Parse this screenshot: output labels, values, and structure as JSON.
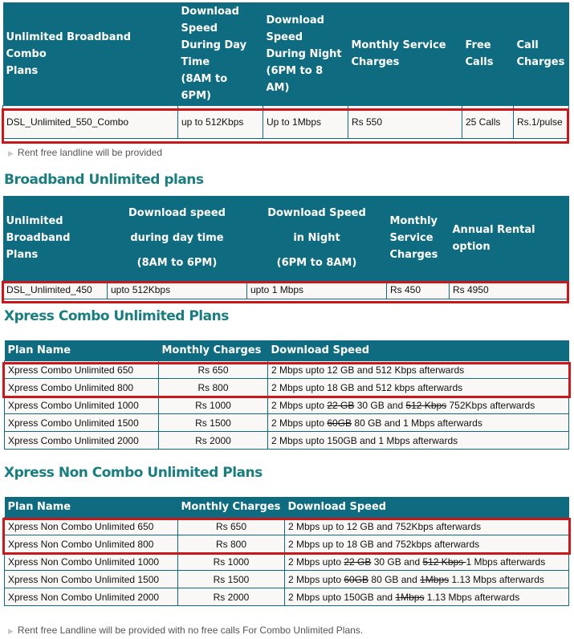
{
  "combo_table": {
    "headers": [
      "Unlimited Broadband Combo Plans",
      "Download Speed During Day Time (8AM to 6PM)",
      "Download Speed During Night (6PM to 8 AM)",
      "Monthly Service Charges",
      "Free Calls",
      "Call Charges"
    ],
    "header_lines": {
      "h0": [
        "Unlimited Broadband Combo",
        "Plans"
      ],
      "h1": [
        "Download",
        "Speed",
        "During Day",
        "Time",
        "(8AM to 6PM)"
      ],
      "h2": [
        "Download",
        "Speed",
        "During Night",
        "(6PM to 8 AM)"
      ],
      "h3": [
        "Monthly Service",
        "Charges"
      ],
      "h4": [
        "Free",
        "Calls"
      ],
      "h5": [
        "Call",
        "Charges"
      ]
    },
    "rows": [
      [
        "DSL_Unlimited_550_Combo",
        "up to 512Kbps",
        "Up to 1Mbps",
        "Rs 550",
        "25 Calls",
        "Rs.1/pulse"
      ]
    ],
    "highlighted_rows": [
      0
    ]
  },
  "combo_note": "Rent free landline will be provided",
  "broadband_section": {
    "title": "Broadband Unlimited plans",
    "header_lines": {
      "h0": [
        "Unlimited",
        "Broadband Plans"
      ],
      "h1": [
        "Download speed",
        "during day time",
        "(8AM to 6PM)"
      ],
      "h2": [
        "Download Speed",
        "in Night",
        "(6PM to 8AM)"
      ],
      "h3": [
        "Monthly",
        "Service",
        "Charges"
      ],
      "h4": [
        "Annual Rental",
        "option"
      ]
    },
    "rows": [
      [
        "DSL_Unlimited_450",
        "upto 512Kbps",
        "upto 1 Mbps",
        "Rs 450",
        "Rs 4950"
      ]
    ],
    "highlighted_rows": [
      0
    ]
  },
  "xpress_combo": {
    "title": "Xpress Combo Unlimited Plans",
    "headers": [
      "Plan Name",
      "Monthly Charges",
      "Download Speed"
    ],
    "rows": [
      {
        "name": "Xpress Combo Unlimited 650",
        "charge": "Rs 650",
        "speed": [
          {
            "t": "2 Mbps upto 12 GB and 512 Kbps afterwards"
          }
        ]
      },
      {
        "name": "Xpress Combo Unlimited 800",
        "charge": "Rs 800",
        "speed": [
          {
            "t": "2 Mbps upto 18 GB and 512 kbps afterwards"
          }
        ]
      },
      {
        "name": "Xpress Combo Unlimited 1000",
        "charge": "Rs 1000",
        "speed": [
          {
            "t": "2 Mbps upto "
          },
          {
            "t": "22 GB",
            "struck": true
          },
          {
            "t": " 30 GB and  "
          },
          {
            "t": "512 Kbps",
            "struck": true
          },
          {
            "t": " 752Kbps afterwards"
          }
        ]
      },
      {
        "name": "Xpress Combo Unlimited 1500",
        "charge": "Rs 1500",
        "speed": [
          {
            "t": "2 Mbps upto "
          },
          {
            "t": "60GB",
            "struck": true
          },
          {
            "t": " 80 GB and 1 Mbps afterwards"
          }
        ]
      },
      {
        "name": "Xpress Combo Unlimited 2000",
        "charge": "Rs 2000",
        "speed": [
          {
            "t": "2 Mbps upto 150GB and 1 Mbps afterwards"
          }
        ]
      }
    ],
    "highlighted_rows": [
      0,
      1
    ]
  },
  "xpress_non_combo": {
    "title": "Xpress Non Combo Unlimited Plans",
    "headers": [
      "Plan Name",
      "Monthly Charges",
      "Download Speed"
    ],
    "rows": [
      {
        "name": "Xpress Non Combo Unlimited 650",
        "charge": "Rs 650",
        "speed": [
          {
            "t": "2 Mbps up to 12 GB and 752Kbps afterwards"
          }
        ]
      },
      {
        "name": "Xpress Non Combo Unlimited 800",
        "charge": "Rs 800",
        "speed": [
          {
            "t": "2 Mbps up to 18 GB and 752kbps afterwards"
          }
        ]
      },
      {
        "name": "Xpress Non Combo Unlimited 1000",
        "charge": "Rs 1000",
        "speed": [
          {
            "t": "2 Mbps upto "
          },
          {
            "t": "22 GB",
            "struck": true
          },
          {
            "t": " 30 GB and "
          },
          {
            "t": "512 Kbps ",
            "struck": true
          },
          {
            "t": "1 Mbps afterwards"
          }
        ]
      },
      {
        "name": "Xpress Non Combo Unlimited 1500",
        "charge": "Rs 1500",
        "speed": [
          {
            "t": "2 Mbps upto "
          },
          {
            "t": "60GB",
            "struck": true
          },
          {
            "t": " 80 GB and "
          },
          {
            "t": "1Mbps",
            "struck": true
          },
          {
            "t": " 1.13 Mbps afterwards"
          }
        ]
      },
      {
        "name": "Xpress Non Combo Unlimited 2000",
        "charge": "Rs 2000",
        "speed": [
          {
            "t": "2 Mbps upto 150GB and "
          },
          {
            "t": "1Mbps",
            "struck": true
          },
          {
            "t": " 1.13 Mbps afterwards"
          }
        ]
      }
    ],
    "highlighted_rows": [
      0,
      1
    ]
  },
  "footer_note": "Rent free Landline will be provided with no free calls For Combo Unlimited Plans.",
  "colors": {
    "header_bg": "#0f6b7f",
    "heading_text": "#1a7d80",
    "highlight_border": "#c8181c",
    "cell_bg": "#faf8f7"
  }
}
